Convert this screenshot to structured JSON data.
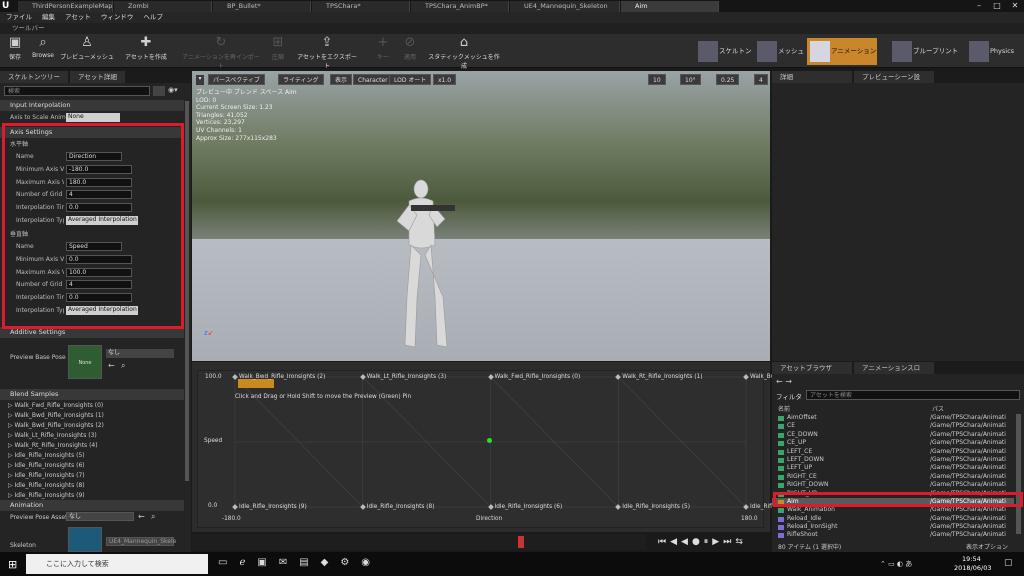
{
  "tabs": [
    "ThirdPersonExampleMap*",
    "Zombi",
    "BP_Bullet*",
    "TPSChara*",
    "TPSChara_AnimBP*",
    "UE4_Mannequin_Skeleton",
    "Aim"
  ],
  "menu": [
    "ファイル",
    "編集",
    "アセット",
    "ウィンドウ",
    "ヘルプ"
  ],
  "toolbar_tab": "ツールバー",
  "tools": [
    "保存",
    "Browse",
    "プレビューメッシュ",
    "アセットを作成",
    "アニメーションを再インポート",
    "圧縮",
    "アセットをエクスポート",
    "キー",
    "適用",
    "スタティックメッシュを作成"
  ],
  "modes": [
    "スケルトン",
    "メッシュ",
    "アニメーション",
    "ブループリント",
    "Physics"
  ],
  "left": {
    "tabs": [
      "スケルトンツリー",
      "アセット詳細"
    ],
    "search": "検索",
    "input_interp": "Input Interpolation",
    "axis_scale_label": "Axis to Scale Animation",
    "axis_scale_value": "None",
    "axis_settings": "Axis Settings",
    "horizontal": "水平軸",
    "vertical": "垂直軸",
    "labels": [
      "Name",
      "Minimum Axis Value",
      "Maximum Axis Value",
      "Number of Grid Divisions",
      "Interpolation Time",
      "Interpolation Type"
    ],
    "h_values": [
      "Direction",
      "-180.0",
      "180.0",
      "4",
      "0.0",
      "Averaged Interpolation"
    ],
    "v_values": [
      "Speed",
      "0.0",
      "100.0",
      "4",
      "0.0",
      "Averaged Interpolation"
    ],
    "additive": "Additive Settings",
    "base_pose": "Preview Base Pose",
    "base_pose_thumb": "None",
    "base_pose_value": "なし",
    "blend_samples": "Blend Samples",
    "samples": [
      "Walk_Fwd_Rifle_Ironsights (0)",
      "Walk_Bwd_Rifle_Ironsights (1)",
      "Walk_Bwd_Rifle_Ironsights (2)",
      "Walk_Lt_Rifle_Ironsights (3)",
      "Walk_Rt_Rifle_Ironsights (4)",
      "Idle_Rifle_Ironsights (5)",
      "Idle_Rifle_Ironsights (6)",
      "Idle_Rifle_Ironsights (7)",
      "Idle_Rifle_Ironsights (8)",
      "Idle_Rifle_Ironsights (9)"
    ],
    "animation": "Animation",
    "preview_pose": "Preview Pose Asset",
    "preview_pose_value": "なし",
    "skeleton": "Skeleton",
    "skeleton_value": "UE4_Mannequin_Skele"
  },
  "viewport": {
    "buttons": [
      "パースペクティブ",
      "ライティング",
      "表示",
      "Character",
      "LOD オート",
      "x1.0"
    ],
    "nums": [
      "10",
      "10°",
      "0.25",
      "4"
    ],
    "info": [
      "プレビュー中 ブレンド スペース Aim",
      "LOD: 0",
      "Current Screen Size: 1.23",
      "Triangles: 41,052",
      "Vertices: 23,297",
      "UV Channels: 1",
      "Approx Size: 277x115x283"
    ]
  },
  "graph": {
    "top_labels": [
      "Walk_Bwd_Rifle_Ironsights (2)",
      "Walk_Lt_Rifle_Ironsights (3)",
      "Walk_Fwd_Rifle_Ironsights (0)",
      "Walk_Rt_Rifle_Ironsights (1)",
      "Walk_Bwd_Rifle_Ironsights (1)"
    ],
    "bottom_labels": [
      "Idle_Rifle_Ironsights (9)",
      "Idle_Rifle_Ironsights (8)",
      "Idle_Rifle_Ironsights (6)",
      "Idle_Rifle_Ironsights (5)",
      "Idle_Rifle_Ironsights (7)"
    ],
    "hint": "Click and Drag or Hold Shift to move the Preview (Green) Pin",
    "y_top": "100.0",
    "y_bottom": "0.0",
    "y_axis": "Speed",
    "x_left": "-180.0",
    "x_right": "180.0",
    "x_axis": "Direction"
  },
  "right": {
    "tabs": [
      "詳細",
      "プレビューシーン設"
    ]
  },
  "browser": {
    "tabs": [
      "アセットブラウザ",
      "アニメーションスロ"
    ],
    "filter": "フィルタ",
    "search": "アセットを検索",
    "col_name": "名前",
    "col_path": "パス",
    "rows": [
      {
        "n": "AimOffset",
        "p": "/Game/TPSChara/Animati"
      },
      {
        "n": "CE",
        "p": "/Game/TPSChara/Animati"
      },
      {
        "n": "CE_DOWN",
        "p": "/Game/TPSChara/Animati"
      },
      {
        "n": "CE_UP",
        "p": "/Game/TPSChara/Animati"
      },
      {
        "n": "LEFT_CE",
        "p": "/Game/TPSChara/Animati"
      },
      {
        "n": "LEFT_DOWN",
        "p": "/Game/TPSChara/Animati"
      },
      {
        "n": "LEFT_UP",
        "p": "/Game/TPSChara/Animati"
      },
      {
        "n": "RIGHT_CE",
        "p": "/Game/TPSChara/Animati"
      },
      {
        "n": "RIGHT_DOWN",
        "p": "/Game/TPSChara/Animati"
      },
      {
        "n": "RIGHT_UP",
        "p": "/Game/TPSChara/Animati"
      },
      {
        "n": "Aim",
        "p": "/Game/TPSChara/Animati"
      },
      {
        "n": "Walk_Animation",
        "p": "/Game/TPSChara/Animati"
      },
      {
        "n": "Reload_Idle",
        "p": "/Game/TPSChara/Animati"
      },
      {
        "n": "Reload_IronSight",
        "p": "/Game/TPSChara/Animati"
      },
      {
        "n": "RifleShoot",
        "p": "/Game/TPSChara/Animati"
      }
    ],
    "status": "80 アイテム (1 選択中)",
    "view": "表示オプション"
  },
  "taskbar": {
    "search": "ここに入力して検索",
    "time": "19:54",
    "date": "2018/06/03"
  }
}
